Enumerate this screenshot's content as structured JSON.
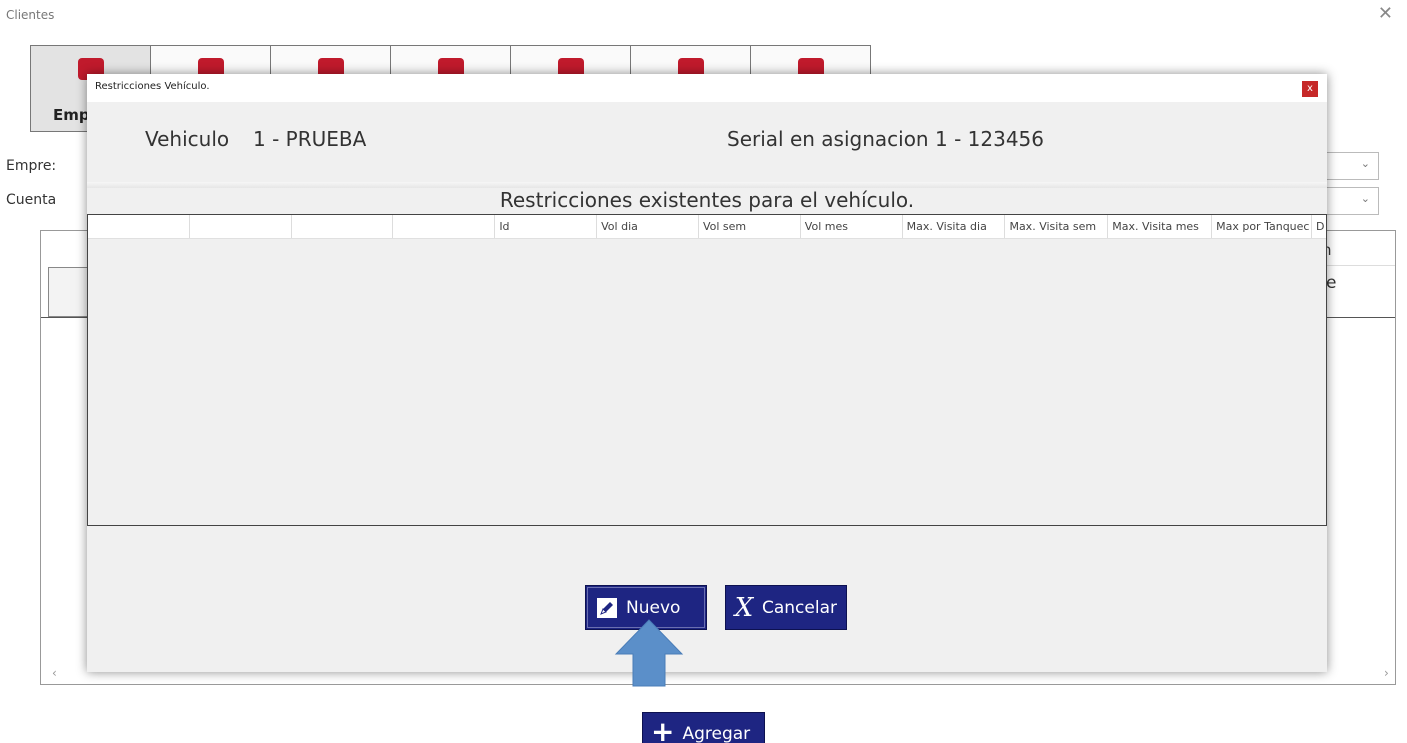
{
  "window": {
    "title": "Clientes",
    "close_glyph": "✕"
  },
  "tabs": [
    {
      "label": "Emp",
      "icon": "briefcase-icon"
    },
    {
      "label": "",
      "icon": "group-icon"
    },
    {
      "label": "",
      "icon": "car-icon"
    },
    {
      "label": "",
      "icon": "fuel-icon"
    },
    {
      "label": "",
      "icon": "person-icon"
    },
    {
      "label": "",
      "icon": "gauge-icon"
    },
    {
      "label": "",
      "icon": "tanks-icon"
    }
  ],
  "background": {
    "empresa_label": "Empre:",
    "cuenta_label": "Cuenta",
    "partial_text_e": "e",
    "partial_text_n": "n",
    "add_button": "Agregar",
    "add_icon": "plus-icon"
  },
  "modal": {
    "title": "Restricciones Vehículo.",
    "close_glyph": "x",
    "vehicle_label": "Vehiculo",
    "vehicle_value": "1 - PRUEBA",
    "serial_label": "Serial en asignacion",
    "serial_value": "1 - 123456",
    "section_title": "Restricciones existentes para el vehículo.",
    "grid_columns": [
      "",
      "",
      "",
      "",
      "Id",
      "Vol dia",
      "Vol sem",
      "Vol mes",
      "Max. Visita dia",
      "Max. Visita sem",
      "Max. Visita mes",
      "Max por Tanquec",
      "D"
    ],
    "grid_rows": [],
    "buttons": {
      "nuevo": "Nuevo",
      "nuevo_icon": "edit-icon",
      "cancelar": "Cancelar",
      "cancelar_icon": "x-icon"
    }
  },
  "colors": {
    "button_bg": "#1e2582",
    "brand_red": "#c01a2c",
    "close_red": "#c62828",
    "arrow": "#5b8fc9"
  }
}
